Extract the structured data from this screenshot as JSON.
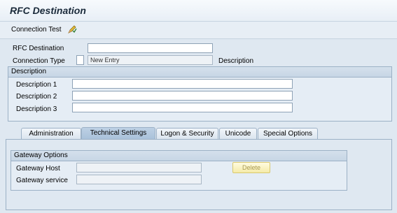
{
  "window": {
    "title": "RFC Destination"
  },
  "toolbar": {
    "connection_test_label": "Connection Test"
  },
  "header_form": {
    "rfc_destination_label": "RFC Destination",
    "rfc_destination_value": "",
    "connection_type_label": "Connection Type",
    "connection_type_code": "",
    "connection_type_text": "New Entry",
    "description_label": "Description"
  },
  "description_group": {
    "title": "Description",
    "fields": [
      {
        "label": "Description 1",
        "value": ""
      },
      {
        "label": "Description 2",
        "value": ""
      },
      {
        "label": "Description 3",
        "value": ""
      }
    ]
  },
  "tabs": [
    {
      "label": "Administration",
      "active": false
    },
    {
      "label": "Technical Settings",
      "active": true
    },
    {
      "label": "Logon & Security",
      "active": false
    },
    {
      "label": "Unicode",
      "active": false
    },
    {
      "label": "Special Options",
      "active": false
    }
  ],
  "gateway_group": {
    "title": "Gateway Options",
    "host_label": "Gateway Host",
    "host_value": "",
    "service_label": "Gateway service",
    "service_value": "",
    "delete_label": "Delete"
  },
  "icons": {
    "connection_test": "pencil-check-icon"
  }
}
